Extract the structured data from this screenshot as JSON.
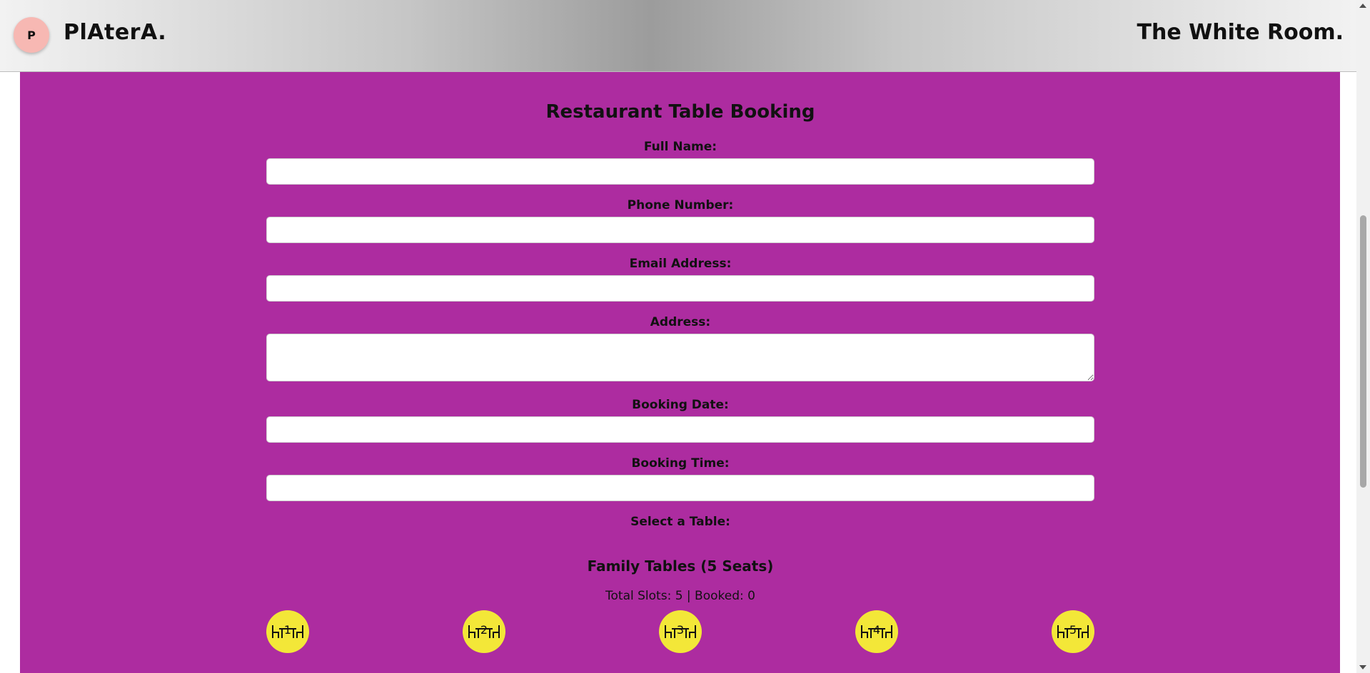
{
  "header": {
    "logo_letter": "P",
    "brand": "PlAterA.",
    "venue": "The White Room."
  },
  "form": {
    "title": "Restaurant Table Booking",
    "full_name": {
      "label": "Full Name:",
      "value": ""
    },
    "phone": {
      "label": "Phone Number:",
      "value": ""
    },
    "email": {
      "label": "Email Address:",
      "value": ""
    },
    "address": {
      "label": "Address:",
      "value": ""
    },
    "date": {
      "label": "Booking Date:",
      "value": ""
    },
    "time": {
      "label": "Booking Time:",
      "value": ""
    },
    "select_table_label": "Select a Table:"
  },
  "family_tables": {
    "title": "Family Tables (5 Seats)",
    "stats": "Total Slots: 5 | Booked: 0",
    "tables": [
      {
        "number": "1"
      },
      {
        "number": "2"
      },
      {
        "number": "3"
      },
      {
        "number": "4"
      },
      {
        "number": "5"
      }
    ]
  },
  "colors": {
    "panel": "#ad2ca0",
    "table_available": "#f3e738",
    "logo_badge": "#f7b8b3"
  },
  "icons": {
    "table": "table-with-chairs-icon"
  }
}
